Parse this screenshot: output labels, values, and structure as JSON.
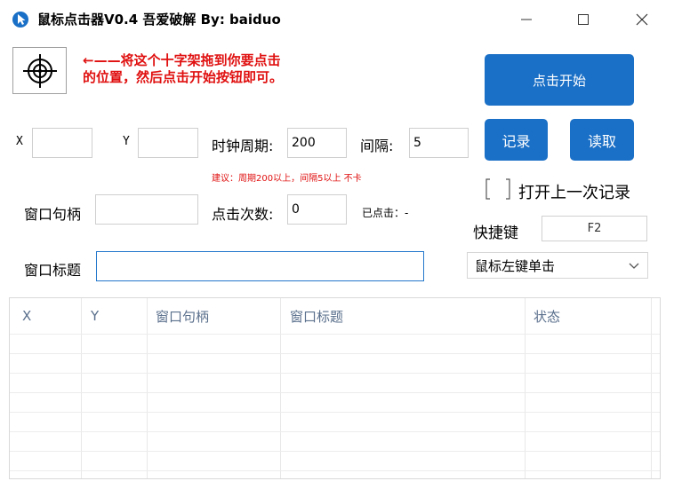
{
  "window": {
    "title": "鼠标点击器V0.4 吾爱破解  By:  baiduo"
  },
  "hint_line1": "←——将这个十字架拖到你要点击",
  "hint_line2": "的位置，然后点击开始按钮即可。",
  "buttons": {
    "start": "点击开始",
    "record": "记录",
    "read": "读取"
  },
  "fields": {
    "x_label": "X",
    "x_value": "",
    "y_label": "Y",
    "y_value": "",
    "clock_label": "时钟周期:",
    "clock_value": "200",
    "interval_label": "间隔:",
    "interval_value": "5",
    "note": "建议：周期200以上，间隔5以上   不卡",
    "handle_label": "窗口句柄",
    "handle_value": "",
    "clicks_label": "点击次数:",
    "clicks_value": "0",
    "clicked_label": "已点击：-",
    "window_title_label": "窗口标题",
    "window_title_value": ""
  },
  "open_last": "打开上一次记录",
  "hotkey": {
    "label": "快捷键",
    "value": "F2"
  },
  "click_mode": {
    "selected": "鼠标左键单击"
  },
  "table": {
    "columns": [
      "X",
      "Y",
      "窗口句柄",
      "窗口标题",
      "状态"
    ],
    "rows": []
  }
}
